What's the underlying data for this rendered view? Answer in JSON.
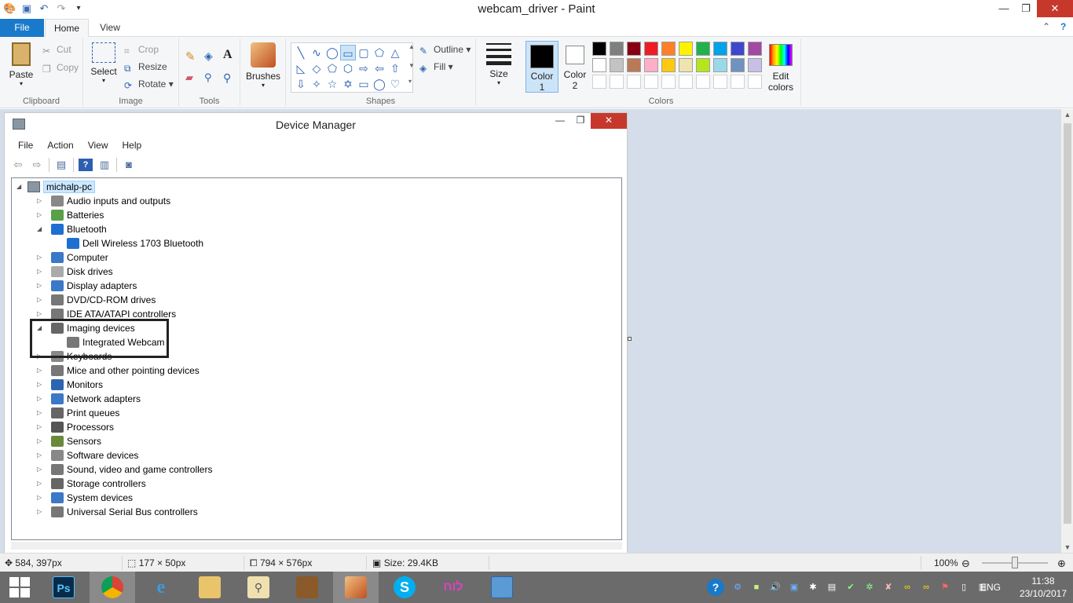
{
  "window": {
    "title": "webcam_driver - Paint",
    "controls": {
      "minimize": "—",
      "maximize": "❐",
      "close": "✕"
    }
  },
  "ribbon": {
    "tabs": [
      "File",
      "Home",
      "View"
    ],
    "clipboard": {
      "label": "Clipboard",
      "paste": "Paste",
      "cut": "Cut",
      "copy": "Copy"
    },
    "image": {
      "label": "Image",
      "select": "Select",
      "crop": "Crop",
      "resize": "Resize",
      "rotate": "Rotate"
    },
    "tools": {
      "label": "Tools"
    },
    "brushes": {
      "label": "Brushes"
    },
    "shapes": {
      "label": "Shapes",
      "outline": "Outline",
      "fill": "Fill"
    },
    "size": {
      "label": "Size"
    },
    "colors": {
      "label": "Colors",
      "color1": "Color\n1",
      "color1_line1": "Color",
      "color1_line2": "1",
      "color2_line1": "Color",
      "color2_line2": "2",
      "edit_line1": "Edit",
      "edit_line2": "colors",
      "palette_row1": [
        "#000000",
        "#7f7f7f",
        "#880015",
        "#ed1c24",
        "#ff7f27",
        "#fff200",
        "#22b14c",
        "#00a2e8",
        "#3f48cc",
        "#a349a4"
      ],
      "palette_row2": [
        "#ffffff",
        "#c3c3c3",
        "#b97a57",
        "#ffaec9",
        "#ffc90e",
        "#efe4b0",
        "#b5e61d",
        "#99d9ea",
        "#7092be",
        "#c8bfe7"
      ]
    }
  },
  "device_manager": {
    "title": "Device Manager",
    "menu": [
      "File",
      "Action",
      "View",
      "Help"
    ],
    "root": "michalp-pc",
    "items": [
      {
        "label": "Audio inputs and outputs",
        "expander": "▷"
      },
      {
        "label": "Batteries",
        "expander": "▷"
      },
      {
        "label": "Bluetooth",
        "expander": "◢"
      },
      {
        "label": "Dell Wireless 1703 Bluetooth",
        "expander": ""
      },
      {
        "label": "Computer",
        "expander": "▷"
      },
      {
        "label": "Disk drives",
        "expander": "▷"
      },
      {
        "label": "Display adapters",
        "expander": "▷"
      },
      {
        "label": "DVD/CD-ROM drives",
        "expander": "▷"
      },
      {
        "label": "IDE ATA/ATAPI controllers",
        "expander": "▷"
      },
      {
        "label": "Imaging devices",
        "expander": "◢"
      },
      {
        "label": "Integrated Webcam",
        "expander": ""
      },
      {
        "label": "Keyboards",
        "expander": "▷"
      },
      {
        "label": "Mice and other pointing devices",
        "expander": "▷"
      },
      {
        "label": "Monitors",
        "expander": "▷"
      },
      {
        "label": "Network adapters",
        "expander": "▷"
      },
      {
        "label": "Print queues",
        "expander": "▷"
      },
      {
        "label": "Processors",
        "expander": "▷"
      },
      {
        "label": "Sensors",
        "expander": "▷"
      },
      {
        "label": "Software devices",
        "expander": "▷"
      },
      {
        "label": "Sound, video and game controllers",
        "expander": "▷"
      },
      {
        "label": "Storage controllers",
        "expander": "▷"
      },
      {
        "label": "System devices",
        "expander": "▷"
      },
      {
        "label": "Universal Serial Bus controllers",
        "expander": "▷"
      }
    ]
  },
  "statusbar": {
    "cursor": "584, 397px",
    "selection": "177 × 50px",
    "canvas": "794 × 576px",
    "size": "Size: 29.4KB",
    "zoom": "100%",
    "zoom_level": 1.0
  },
  "taskbar": {
    "apps": [
      "Ps",
      "Chrome",
      "IE",
      "Explorer",
      "Search",
      "App",
      "Paint",
      "Skype",
      "לוח",
      "Calculator"
    ],
    "lang": "ENG",
    "time": "11:38",
    "date": "23/10/2017"
  }
}
